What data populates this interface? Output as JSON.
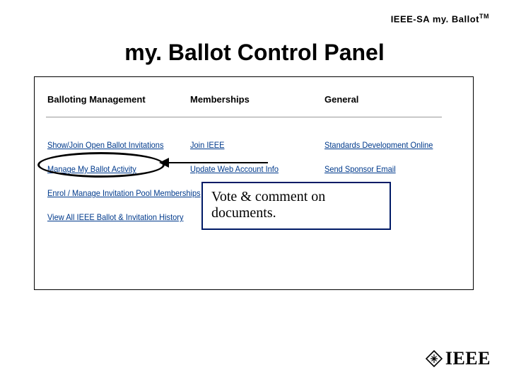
{
  "header": {
    "brand": "IEEE-SA my. Ballot",
    "tm": "TM"
  },
  "title": "my. Ballot Control Panel",
  "columns": {
    "c1": {
      "head": "Balloting Management",
      "links": [
        "Show/Join Open Ballot Invitations",
        "Manage My Ballot Activity",
        "Enrol / Manage Invitation Pool Memberships",
        "View All IEEE Ballot & Invitation History"
      ]
    },
    "c2": {
      "head": "Memberships",
      "links": [
        "Join IEEE",
        "Update Web Account Info"
      ]
    },
    "c3": {
      "head": "General",
      "links": [
        "Standards Development Online",
        "Send Sponsor Email"
      ]
    }
  },
  "callout": "Vote & comment on documents.",
  "logo": {
    "text": "IEEE"
  }
}
